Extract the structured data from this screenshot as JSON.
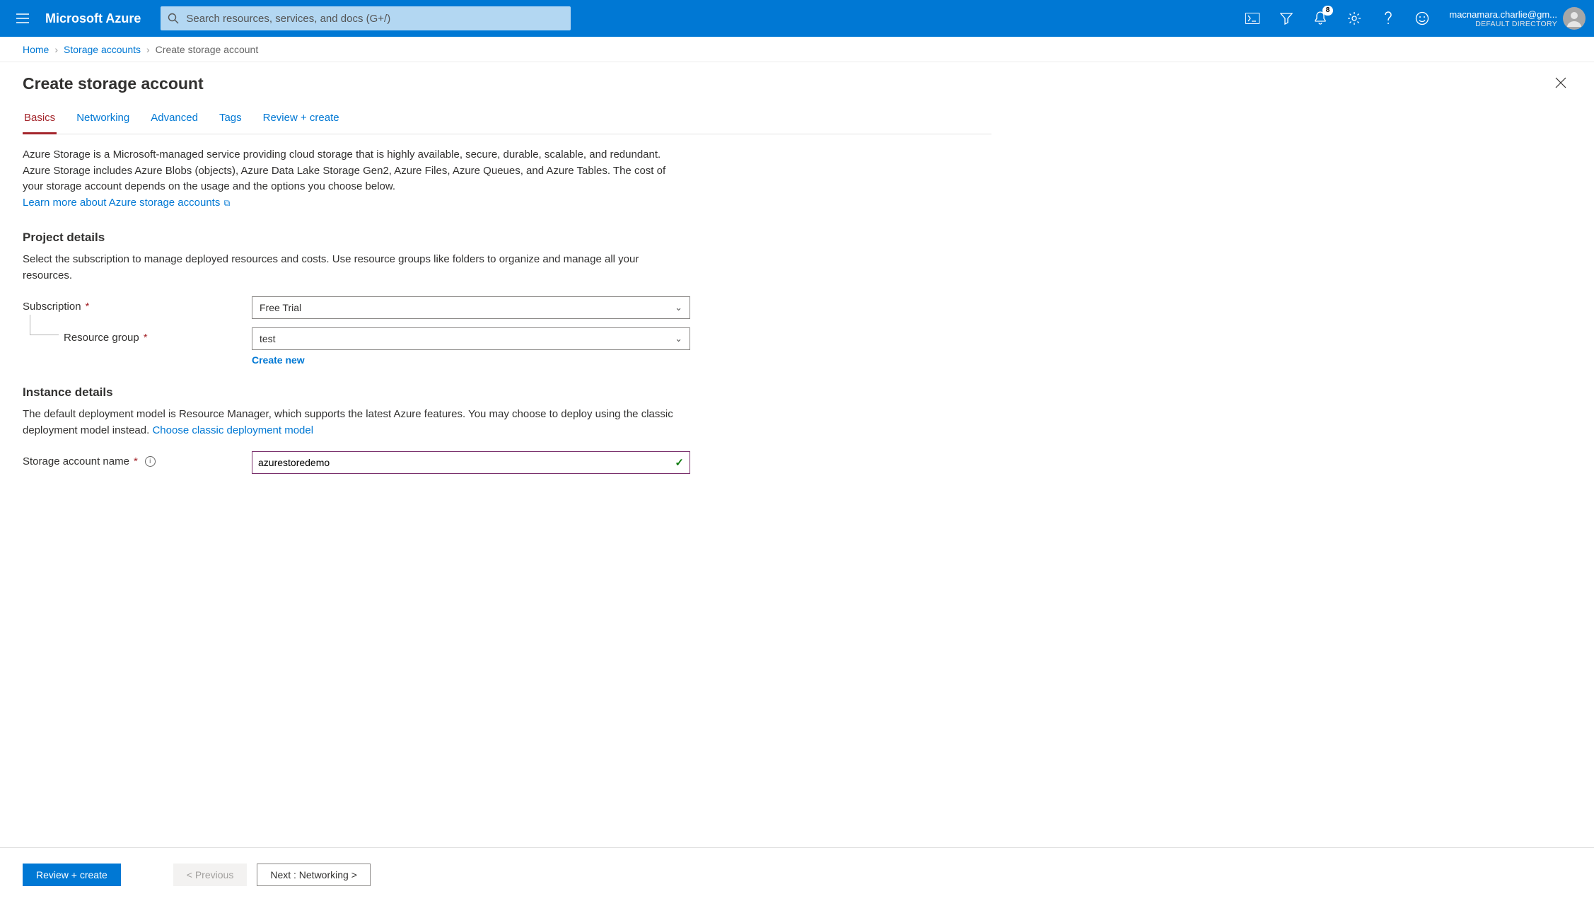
{
  "topbar": {
    "brand": "Microsoft Azure",
    "search_placeholder": "Search resources, services, and docs (G+/)",
    "notification_count": "8",
    "account_email": "macnamara.charlie@gm...",
    "account_directory": "DEFAULT DIRECTORY"
  },
  "breadcrumb": {
    "items": [
      "Home",
      "Storage accounts"
    ],
    "current": "Create storage account"
  },
  "blade": {
    "title": "Create storage account"
  },
  "tabs": [
    "Basics",
    "Networking",
    "Advanced",
    "Tags",
    "Review + create"
  ],
  "intro": {
    "text": "Azure Storage is a Microsoft-managed service providing cloud storage that is highly available, secure, durable, scalable, and redundant. Azure Storage includes Azure Blobs (objects), Azure Data Lake Storage Gen2, Azure Files, Azure Queues, and Azure Tables. The cost of your storage account depends on the usage and the options you choose below.",
    "learn_more": "Learn more about Azure storage accounts"
  },
  "project": {
    "heading": "Project details",
    "desc": "Select the subscription to manage deployed resources and costs. Use resource groups like folders to organize and manage all your resources.",
    "subscription_label": "Subscription",
    "subscription_value": "Free Trial",
    "rg_label": "Resource group",
    "rg_value": "test",
    "create_new": "Create new"
  },
  "instance": {
    "heading": "Instance details",
    "desc_pre": "The default deployment model is Resource Manager, which supports the latest Azure features. You may choose to deploy using the classic deployment model instead.  ",
    "classic_link": "Choose classic deployment model",
    "name_label": "Storage account name",
    "name_value": "azurestoredemo"
  },
  "footer": {
    "review": "Review + create",
    "previous": "< Previous",
    "next": "Next : Networking >"
  }
}
